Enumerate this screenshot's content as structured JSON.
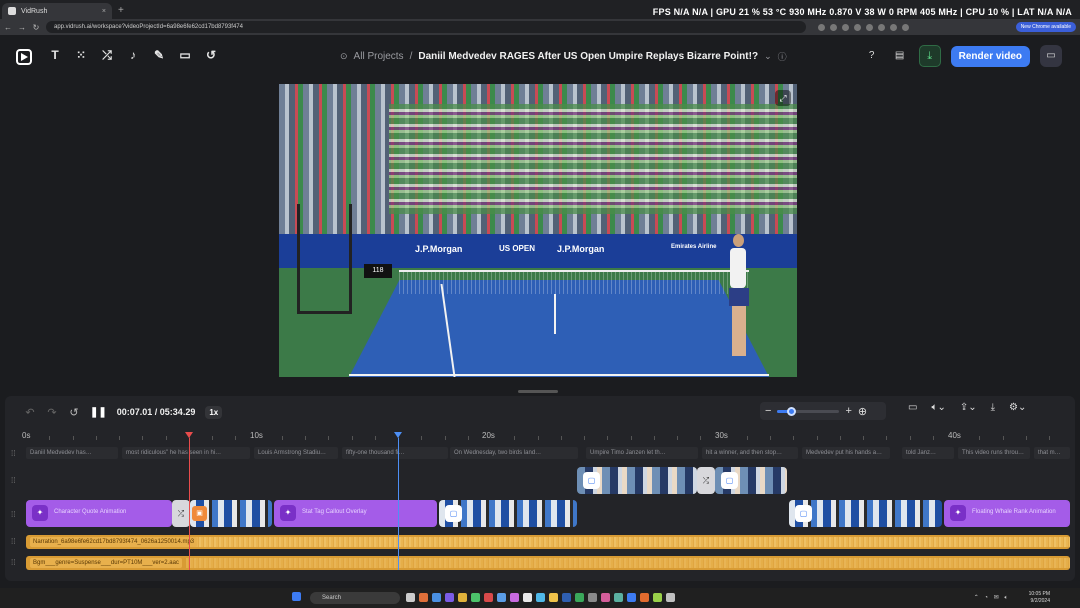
{
  "browser": {
    "tab_title": "VidRush",
    "tab_close": "×",
    "new_tab": "+",
    "url": "app.vidrush.ai/workspace?videoProjectId=6a98e6fe62cd17bd8793f474",
    "new_chrome": "New Chrome available",
    "overlay_stats": "FPS  N/A  N/A   |  GPU 21 %  53 °C  930 MHz  0.870 V  38 W  0 RPM  405 MHz   |  CPU  10 %   |  LAT  N/A  N/A"
  },
  "header": {
    "breadcrumb_all": "All Projects",
    "breadcrumb_sep": "/",
    "project_title": "Daniil Medvedev RAGES After US Open Umpire Replays Bizarre Point!?",
    "render_label": "Render video",
    "tools": [
      "text-tool",
      "elements-tool",
      "transitions-tool",
      "audio-tool",
      "effects-tool",
      "folder-tool",
      "history-tool"
    ],
    "tool_glyphs": [
      "T",
      "⁙",
      "⤮",
      "♪",
      "✎",
      "▭",
      "↺"
    ]
  },
  "preview": {
    "banner_left": "J.P.Morgan",
    "banner_mid": "US OPEN",
    "banner_right": "J.P.Morgan",
    "banner_far_right": "Emirates Airline",
    "scoreboard": "118"
  },
  "timeline": {
    "current_time": "00:07.01",
    "total_time": "05:34.29",
    "time_display": "00:07.01 / 05:34.29",
    "speed": "1x",
    "zoom_level": 0.22,
    "red_playhead_seconds": 7.0,
    "blue_playhead_seconds": 16.0,
    "ruler_labels": [
      "0s",
      "10s",
      "20s",
      "30s",
      "40s"
    ],
    "captions": [
      "Daniil Medvedev has…",
      "most ridiculous\" he has seen in hi…",
      "Louis Armstrong Stadiu…",
      "fifty-one thousand fi…",
      "On Wednesday, two birds land…",
      "Umpire Timo Janzen let th…",
      "hit a winner, and then stop…",
      "Medvedev put his hands a…",
      "told Janz…",
      "This video runs throu…",
      "that m…"
    ],
    "purple_clips": [
      "Character Quote Animation",
      "Stat Tag Callout Overlay",
      "Floating Whale Rank Animation"
    ],
    "audio_tracks": [
      "Narration_6a98e6fe62cd17bd8793f474_0626a1250014.mp3",
      "Bgm___genre=Suspense___dur=PT10M___ver=2.aac"
    ]
  },
  "taskbar": {
    "search": "Search",
    "clock_time": "10:05 PM",
    "clock_date": "9/2/2024"
  }
}
